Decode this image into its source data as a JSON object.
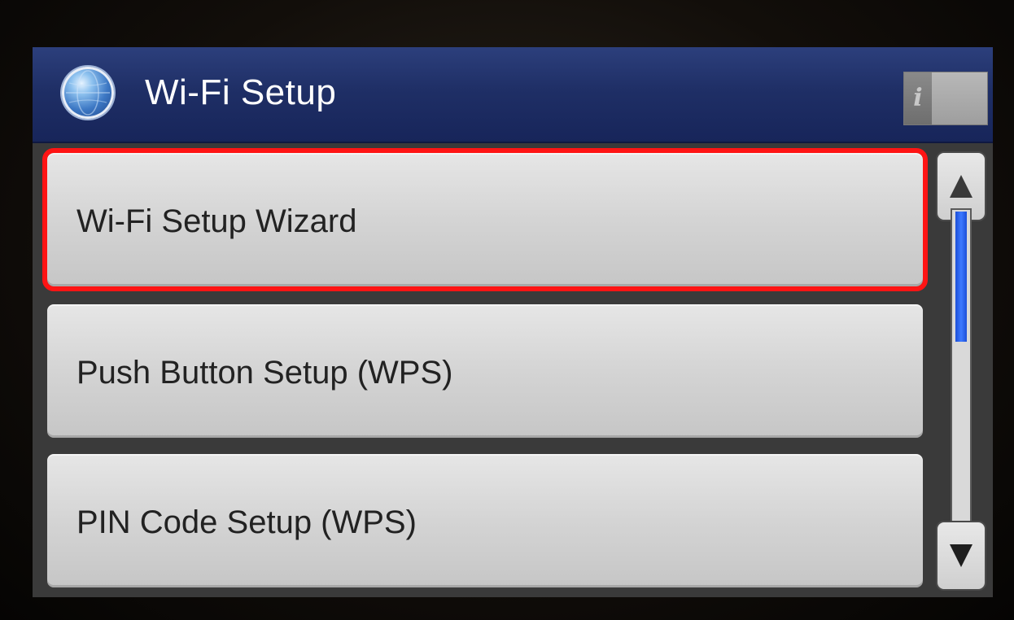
{
  "header": {
    "title": "Wi-Fi Setup",
    "icon": "globe-icon",
    "info_label": "i"
  },
  "menu": {
    "items": [
      {
        "label": "Wi-Fi Setup Wizard",
        "selected": true
      },
      {
        "label": "Push Button Setup (WPS)",
        "selected": false
      },
      {
        "label": "PIN Code Setup (WPS)",
        "selected": false
      }
    ]
  },
  "scroll": {
    "up_icon": "triangle-up-icon",
    "down_icon": "triangle-down-icon",
    "position": 0
  },
  "colors": {
    "header_bg": "#1f2f66",
    "selection_outline": "#ff1414",
    "scroll_thumb": "#2f64f0"
  }
}
